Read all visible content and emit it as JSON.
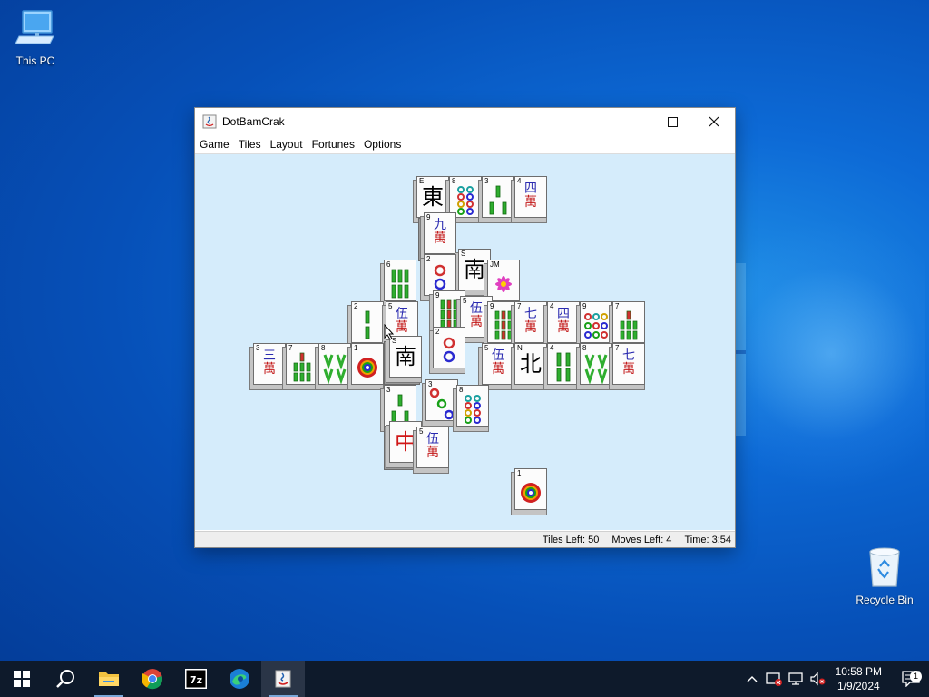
{
  "desktop": {
    "icons": [
      {
        "label": "This PC"
      },
      {
        "label": "Recycle Bin"
      }
    ]
  },
  "window": {
    "title": "DotBamCrak",
    "menu": [
      "Game",
      "Tiles",
      "Layout",
      "Fortunes",
      "Options"
    ],
    "status": {
      "tiles_left": "Tiles Left: 50",
      "moves_left": "Moves Left: 4",
      "time": "Time: 3:54"
    }
  },
  "tiles": {
    "t1": {
      "num": "E",
      "glyph": "東"
    },
    "t2": {
      "num": "8"
    },
    "t3": {
      "num": "3"
    },
    "t4": {
      "num": "4",
      "n": "四",
      "w": "萬"
    },
    "t5": {
      "num": "9",
      "n": "九",
      "w": "萬"
    },
    "t6": {
      "num": "S",
      "glyph": "南"
    },
    "t7": {
      "num": "JM"
    },
    "t8": {
      "num": "2"
    },
    "t9": {
      "num": "6"
    },
    "t10": {
      "num": "9"
    },
    "t11": {
      "num": "5",
      "n": "伍",
      "w": "萬"
    },
    "t12": {
      "num": "2"
    },
    "t13": {
      "num": "5",
      "n": "伍",
      "w": "萬"
    },
    "t14": {
      "num": "9"
    },
    "t15": {
      "num": "7",
      "n": "七",
      "w": "萬"
    },
    "t16": {
      "num": "4",
      "n": "四",
      "w": "萬"
    },
    "t17": {
      "num": "9"
    },
    "t18": {
      "num": "7"
    },
    "t19": {
      "num": "3",
      "n": "三",
      "w": "萬"
    },
    "t20": {
      "num": "7"
    },
    "t21": {
      "num": "8"
    },
    "t22": {
      "num": "1"
    },
    "t23": {
      "num": "S",
      "glyph": "南"
    },
    "t24": {
      "num": "2"
    },
    "t25": {
      "num": "5",
      "n": "伍",
      "w": "萬"
    },
    "t26": {
      "num": "N",
      "glyph": "北"
    },
    "t27": {
      "num": "4"
    },
    "t28": {
      "num": "8"
    },
    "t29": {
      "num": "7",
      "n": "七",
      "w": "萬"
    },
    "t30": {
      "num": "3"
    },
    "t31": {
      "num": "3"
    },
    "t32": {
      "num": "8"
    },
    "t33": {
      "num": "",
      "glyph": "中"
    },
    "t34": {
      "num": "5",
      "n": "伍",
      "w": "萬"
    },
    "t35": {
      "num": "1"
    }
  },
  "taskbar": {
    "clock_time": "10:58 PM",
    "clock_date": "1/9/2024",
    "notification_count": "1",
    "colors": {
      "bar": "#0e1a2b",
      "active": "#2a3547"
    }
  }
}
